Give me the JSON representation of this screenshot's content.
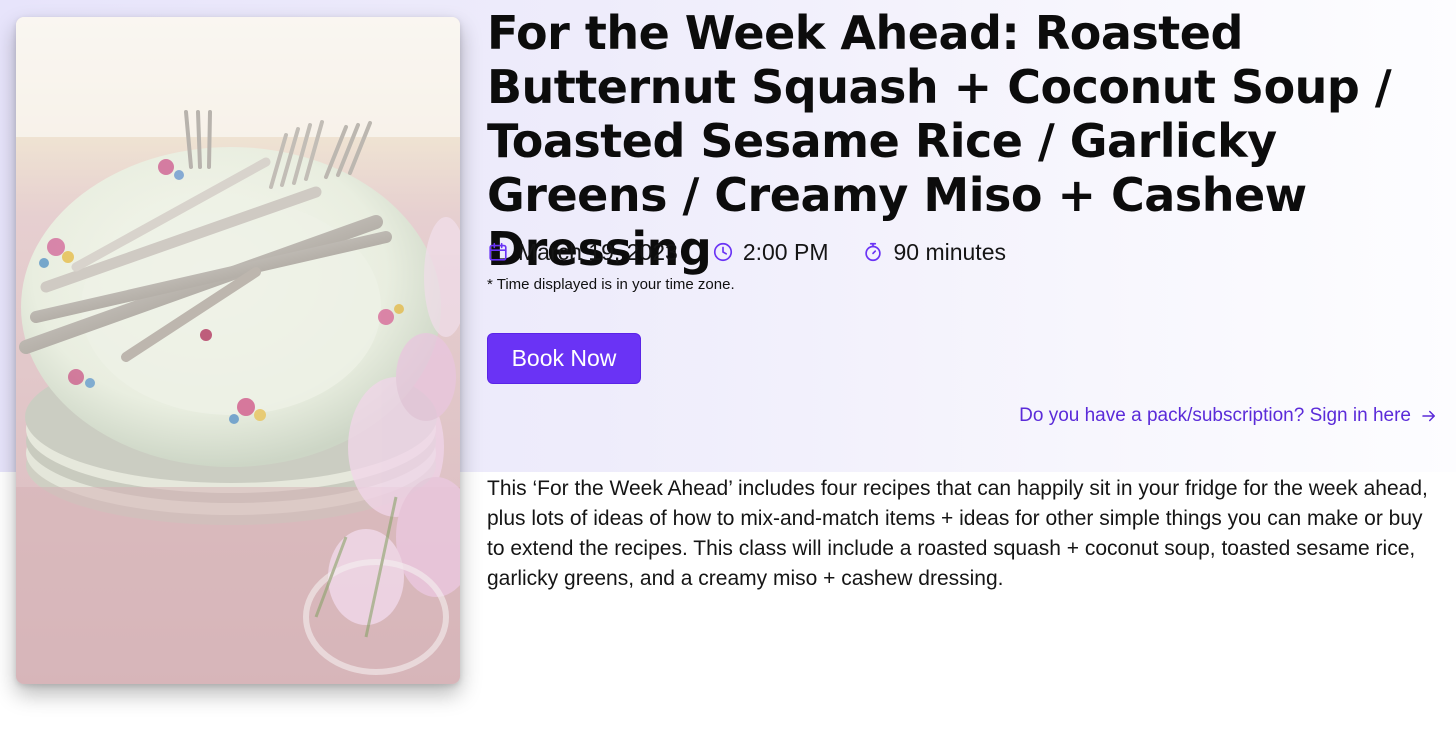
{
  "event": {
    "title": "For the Week Ahead: Roasted Butternut Squash + Coconut Soup / Toasted Sesame Rice / Garlicky Greens / Creamy Miso + Cashew Dressing",
    "date": "March 19, 2023",
    "time": "2:00 PM",
    "duration": "90 minutes",
    "timezone_note": "* Time displayed is in your time zone.",
    "description": "This ‘For the Week Ahead’ includes four recipes that can happily sit in your fridge for the week ahead, plus lots of ideas of how to mix-and-match items + ideas for other simple things you can make or buy to extend the recipes. This class will include a roasted squash + coconut soup, toasted sesame rice, garlicky greens, and a creamy miso + cashew dressing."
  },
  "actions": {
    "book_label": "Book Now",
    "signin_label": "Do you have a pack/subscription? Sign in here"
  },
  "icons": {
    "date": "calendar-icon",
    "time": "clock-icon",
    "duration": "stopwatch-icon",
    "signin": "arrow-right-icon"
  },
  "colors": {
    "accent": "#6a33f5",
    "link": "#5b2bd9",
    "hero_background": "#e9e6fb"
  }
}
